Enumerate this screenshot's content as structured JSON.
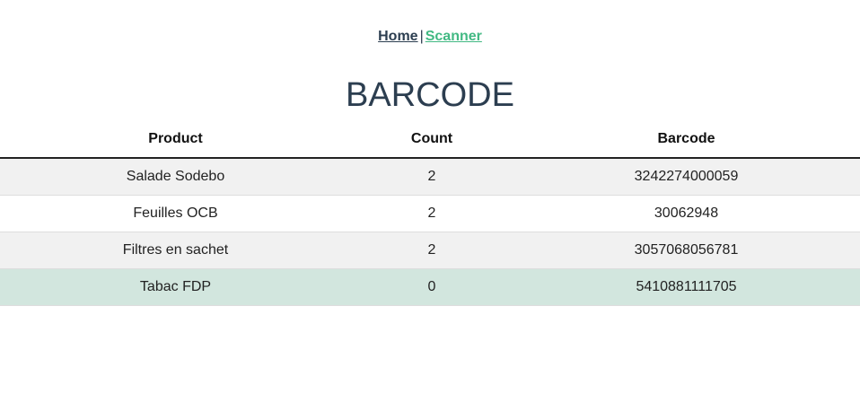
{
  "nav": {
    "home_label": "Home",
    "separator": "|",
    "scanner_label": "Scanner"
  },
  "page": {
    "title": "BARCODE"
  },
  "table": {
    "headers": {
      "product": "Product",
      "count": "Count",
      "barcode": "Barcode"
    },
    "rows": [
      {
        "product": "Salade Sodebo",
        "count": "2",
        "barcode": "3242274000059"
      },
      {
        "product": "Feuilles OCB",
        "count": "2",
        "barcode": "30062948"
      },
      {
        "product": "Filtres en sachet",
        "count": "2",
        "barcode": "3057068056781"
      },
      {
        "product": "Tabac FDP",
        "count": "0",
        "barcode": "5410881111705"
      }
    ]
  },
  "colors": {
    "text": "#2c3e50",
    "link_active": "#42b983",
    "row_stripe": "#f1f1f1",
    "row_highlight": "#d2e6de"
  }
}
